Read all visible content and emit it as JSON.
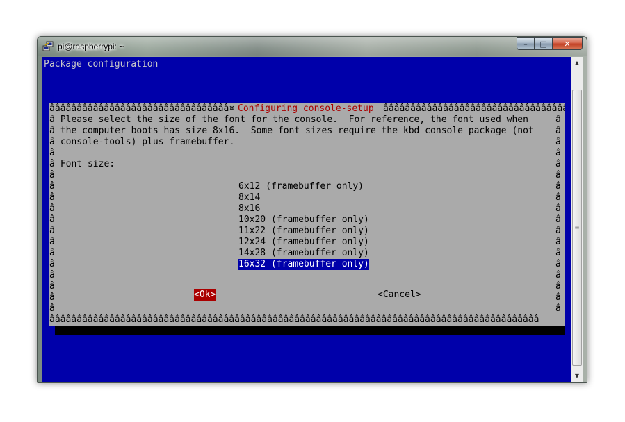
{
  "window": {
    "title": "pi@raspberrypi: ~",
    "minimize_glyph": "–",
    "maximize_glyph": "□",
    "close_glyph": "✕"
  },
  "terminal": {
    "backtitle": "Package configuration",
    "colors": {
      "background": "#0000aa",
      "dialog": "#aaaaaa",
      "title": "#aa0000",
      "selected": "#0000aa",
      "button_active": "#aa0000"
    }
  },
  "dialog": {
    "border_top_left": "âââââââââââââââââââââââââââââââââ¤",
    "border_top_right": "âââââââââââââââââââââââââââââââââââ",
    "title": "Configuring console-setup",
    "border_side": "â",
    "border_bottom": "ââââââââââââââââââââââââââââââââââââââââââââââââââââââââââââââââââââââââââââââââââââââââââ",
    "message_lines": [
      " Please select the size of the font for the console.  For reference, the font used when",
      " the computer boots has size 8x16.  Some font sizes require the kbd console package (not",
      " console-tools) plus framebuffer.",
      "",
      " Font size:"
    ],
    "options": [
      "6x12 (framebuffer only)",
      "8x14",
      "8x16",
      "10x20 (framebuffer only)",
      "11x22 (framebuffer only)",
      "12x24 (framebuffer only)",
      "14x28 (framebuffer only)",
      "16x32 (framebuffer only)"
    ],
    "selected_option": "16x32 (framebuffer only)",
    "ok_label": "<Ok>",
    "cancel_label": "<Cancel>"
  },
  "scrollbar": {
    "up_glyph": "▲",
    "down_glyph": "▼",
    "grip_glyph": "≡"
  }
}
